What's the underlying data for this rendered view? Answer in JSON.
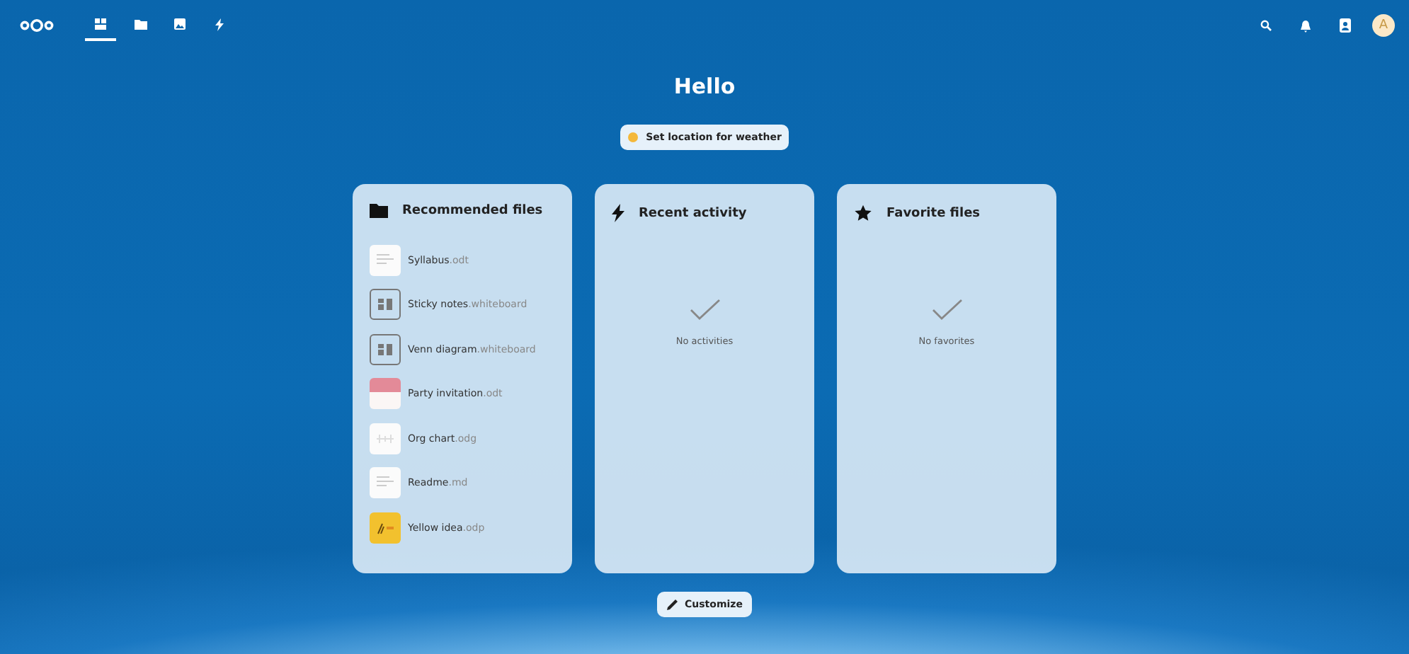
{
  "header": {
    "apps": [
      {
        "kind": "dashboard",
        "selected": true
      },
      {
        "kind": "files",
        "selected": false
      },
      {
        "kind": "photos",
        "selected": false
      },
      {
        "kind": "activity",
        "selected": false
      }
    ],
    "avatar": "A"
  },
  "greeting": "Hello",
  "weather_button": "Set location for weather",
  "widgets": [
    {
      "kind": "files",
      "title": "Recommended files",
      "files": [
        {
          "name": "Syllabus",
          "ext": ".odt",
          "kind": "document"
        },
        {
          "name": "Sticky notes",
          "ext": ".whiteboard",
          "kind": "whiteboard"
        },
        {
          "name": "Venn diagram",
          "ext": ".whiteboard",
          "kind": "whiteboard"
        },
        {
          "name": "Party invitation",
          "ext": ".odt",
          "kind": "invitation"
        },
        {
          "name": "Org chart",
          "ext": ".odg",
          "kind": "chart"
        },
        {
          "name": "Readme",
          "ext": ".md",
          "kind": "document"
        },
        {
          "name": "Yellow idea",
          "ext": ".odp",
          "kind": "slide"
        }
      ]
    },
    {
      "kind": "activity",
      "title": "Recent activity",
      "empty": "No activities"
    },
    {
      "kind": "favorites",
      "title": "Favorite files",
      "empty": "No favorites"
    }
  ],
  "customize_button": "Customize"
}
